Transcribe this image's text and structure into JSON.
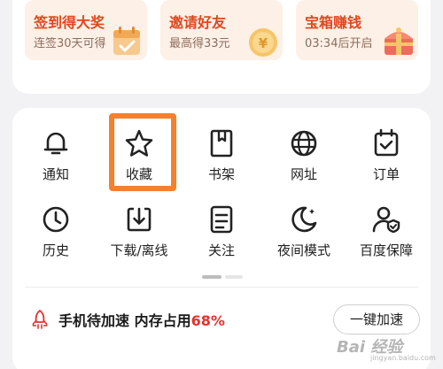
{
  "colors": {
    "accent_red": "#e1461e",
    "highlight_orange": "#f5802e",
    "percent_red": "#e5322e",
    "tile_bg": "#fdf0e6"
  },
  "promos": [
    {
      "title": "签到得大奖",
      "subtitle": "连签30天可得",
      "icon": "calendar-gift-icon"
    },
    {
      "title": "邀请好友",
      "subtitle": "最高得33元",
      "icon": "yuan-coin-icon"
    },
    {
      "title": "宝箱赚钱",
      "subtitle": "03:34后开启",
      "icon": "treasure-chest-icon"
    }
  ],
  "tools_row1": [
    {
      "label": "通知",
      "icon": "bell-icon"
    },
    {
      "label": "收藏",
      "icon": "star-icon"
    },
    {
      "label": "书架",
      "icon": "bookmark-book-icon"
    },
    {
      "label": "网址",
      "icon": "globe-icon"
    },
    {
      "label": "订单",
      "icon": "order-calendar-check-icon"
    }
  ],
  "tools_row2": [
    {
      "label": "历史",
      "icon": "clock-icon"
    },
    {
      "label": "下载/离线",
      "icon": "download-icon"
    },
    {
      "label": "关注",
      "icon": "list-doc-icon"
    },
    {
      "label": "夜间模式",
      "icon": "moon-icon"
    },
    {
      "label": "百度保障",
      "icon": "user-shield-icon"
    }
  ],
  "boost": {
    "icon": "rocket-icon",
    "text": "手机待加速 内存占用",
    "percent": "68%",
    "button_label": "一键加速"
  },
  "watermark": {
    "text": "Bai 经验",
    "sub": "jingyan.baidu.com"
  }
}
